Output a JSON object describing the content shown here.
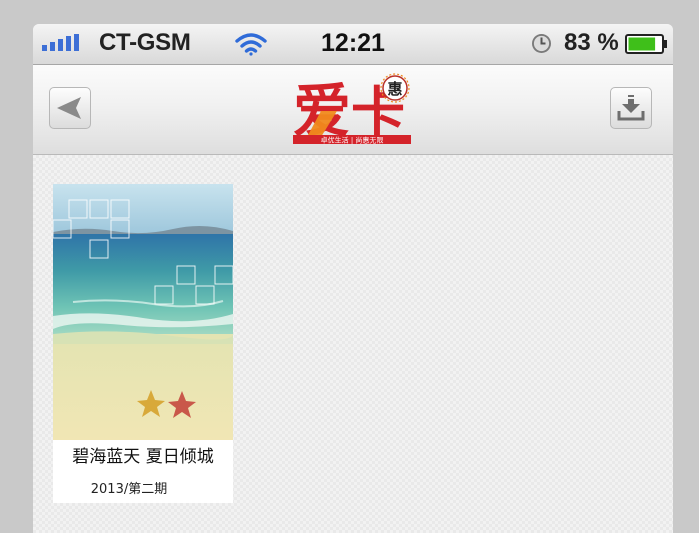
{
  "status_bar": {
    "carrier": "CT-GSM",
    "time": "12:21",
    "battery_percent": "83 %",
    "battery_level": 0.83,
    "icons": [
      "signal-bars-icon",
      "wifi-icon",
      "alarm-clock-icon",
      "battery-icon"
    ]
  },
  "navbar": {
    "back_icon": "back-arrow-icon",
    "download_icon": "download-tray-icon",
    "logo": {
      "name": "爱卡",
      "emblem_char": "惠",
      "tagline": "卓优生活 | 尚惠无限"
    }
  },
  "magazines": [
    {
      "title": "碧海蓝天 夏日倾城",
      "issue": "2013/第二期",
      "cover": "beach-with-starfish"
    }
  ],
  "colors": {
    "logo_red": "#d4232a",
    "logo_orange": "#f08a1c",
    "battery_green": "#3fbf1a",
    "status_blue": "#3d6fd6"
  }
}
